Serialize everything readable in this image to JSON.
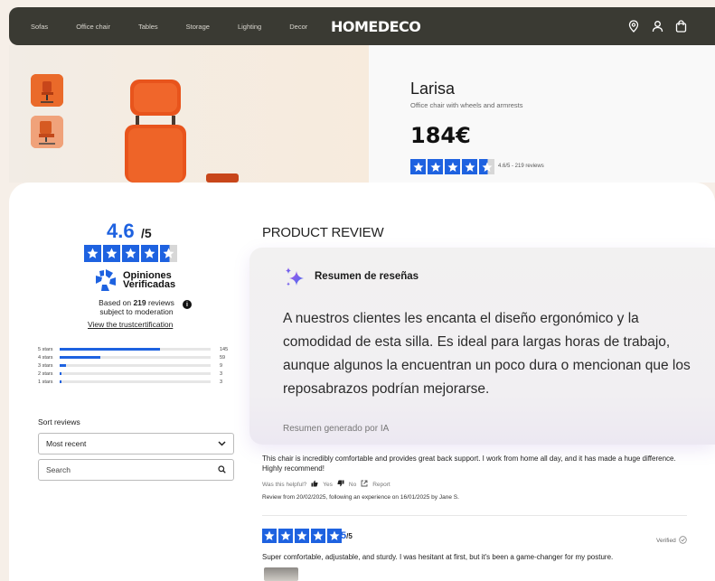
{
  "nav": {
    "links": [
      "Sofas",
      "Office chair",
      "Tables",
      "Storage",
      "Lighting",
      "Decor"
    ],
    "logo": "HOMEDECO",
    "icons": [
      "location-icon",
      "user-icon",
      "bag-icon"
    ]
  },
  "product": {
    "name": "Larisa",
    "subtitle": "Office chair with wheels and armrests",
    "price": "184€",
    "rating_text": "4.6/5 - 219 reviews",
    "rating": 4.6,
    "accent": "#1e62e0",
    "chair_color": "#e8541c"
  },
  "overall": {
    "score": "4.6",
    "denominator": "/5",
    "brand_line1": "Opiniones",
    "brand_line2": "Verificadas",
    "based_pre": "Based on ",
    "based_count": "219",
    "based_post": " reviews subject to moderation",
    "trust_link": "View the trustcertification"
  },
  "distribution": [
    {
      "label": "5 stars",
      "count": "145",
      "value": 145
    },
    {
      "label": "4 stars",
      "count": "59",
      "value": 59
    },
    {
      "label": "3 stars",
      "count": "9",
      "value": 9
    },
    {
      "label": "2 stars",
      "count": "3",
      "value": 3
    },
    {
      "label": "1 stars",
      "count": "3",
      "value": 3
    }
  ],
  "sort": {
    "label": "Sort reviews",
    "selected": "Most recent",
    "search_placeholder": "Search"
  },
  "section_title": "PRODUCT REVIEW",
  "summary": {
    "title": "Resumen de reseñas",
    "body": "A nuestros clientes les encanta el diseño ergonómico y la comodidad de esta silla. Es ideal para largas horas de trabajo, aunque algunos la encuentran un poco dura o mencionan que los reposabrazos podrían mejorarse.",
    "footer": "Resumen generado por IA"
  },
  "reviews": [
    {
      "text": "This chair is incredibly comfortable and provides great back support. I work from home all day, and it has made a huge difference. Highly recommend!",
      "helpful_label": "Was this helpful?",
      "yes": "Yes",
      "no": "No",
      "report": "Report",
      "meta": "Review from 20/02/2025, following an experience on 16/01/2025 by Jane S."
    },
    {
      "score": "5",
      "denominator": "/5",
      "verified": "Verified",
      "text": "Super comfortable, adjustable, and sturdy. I was hesitant at first, but it's been a game-changer for my posture."
    }
  ]
}
